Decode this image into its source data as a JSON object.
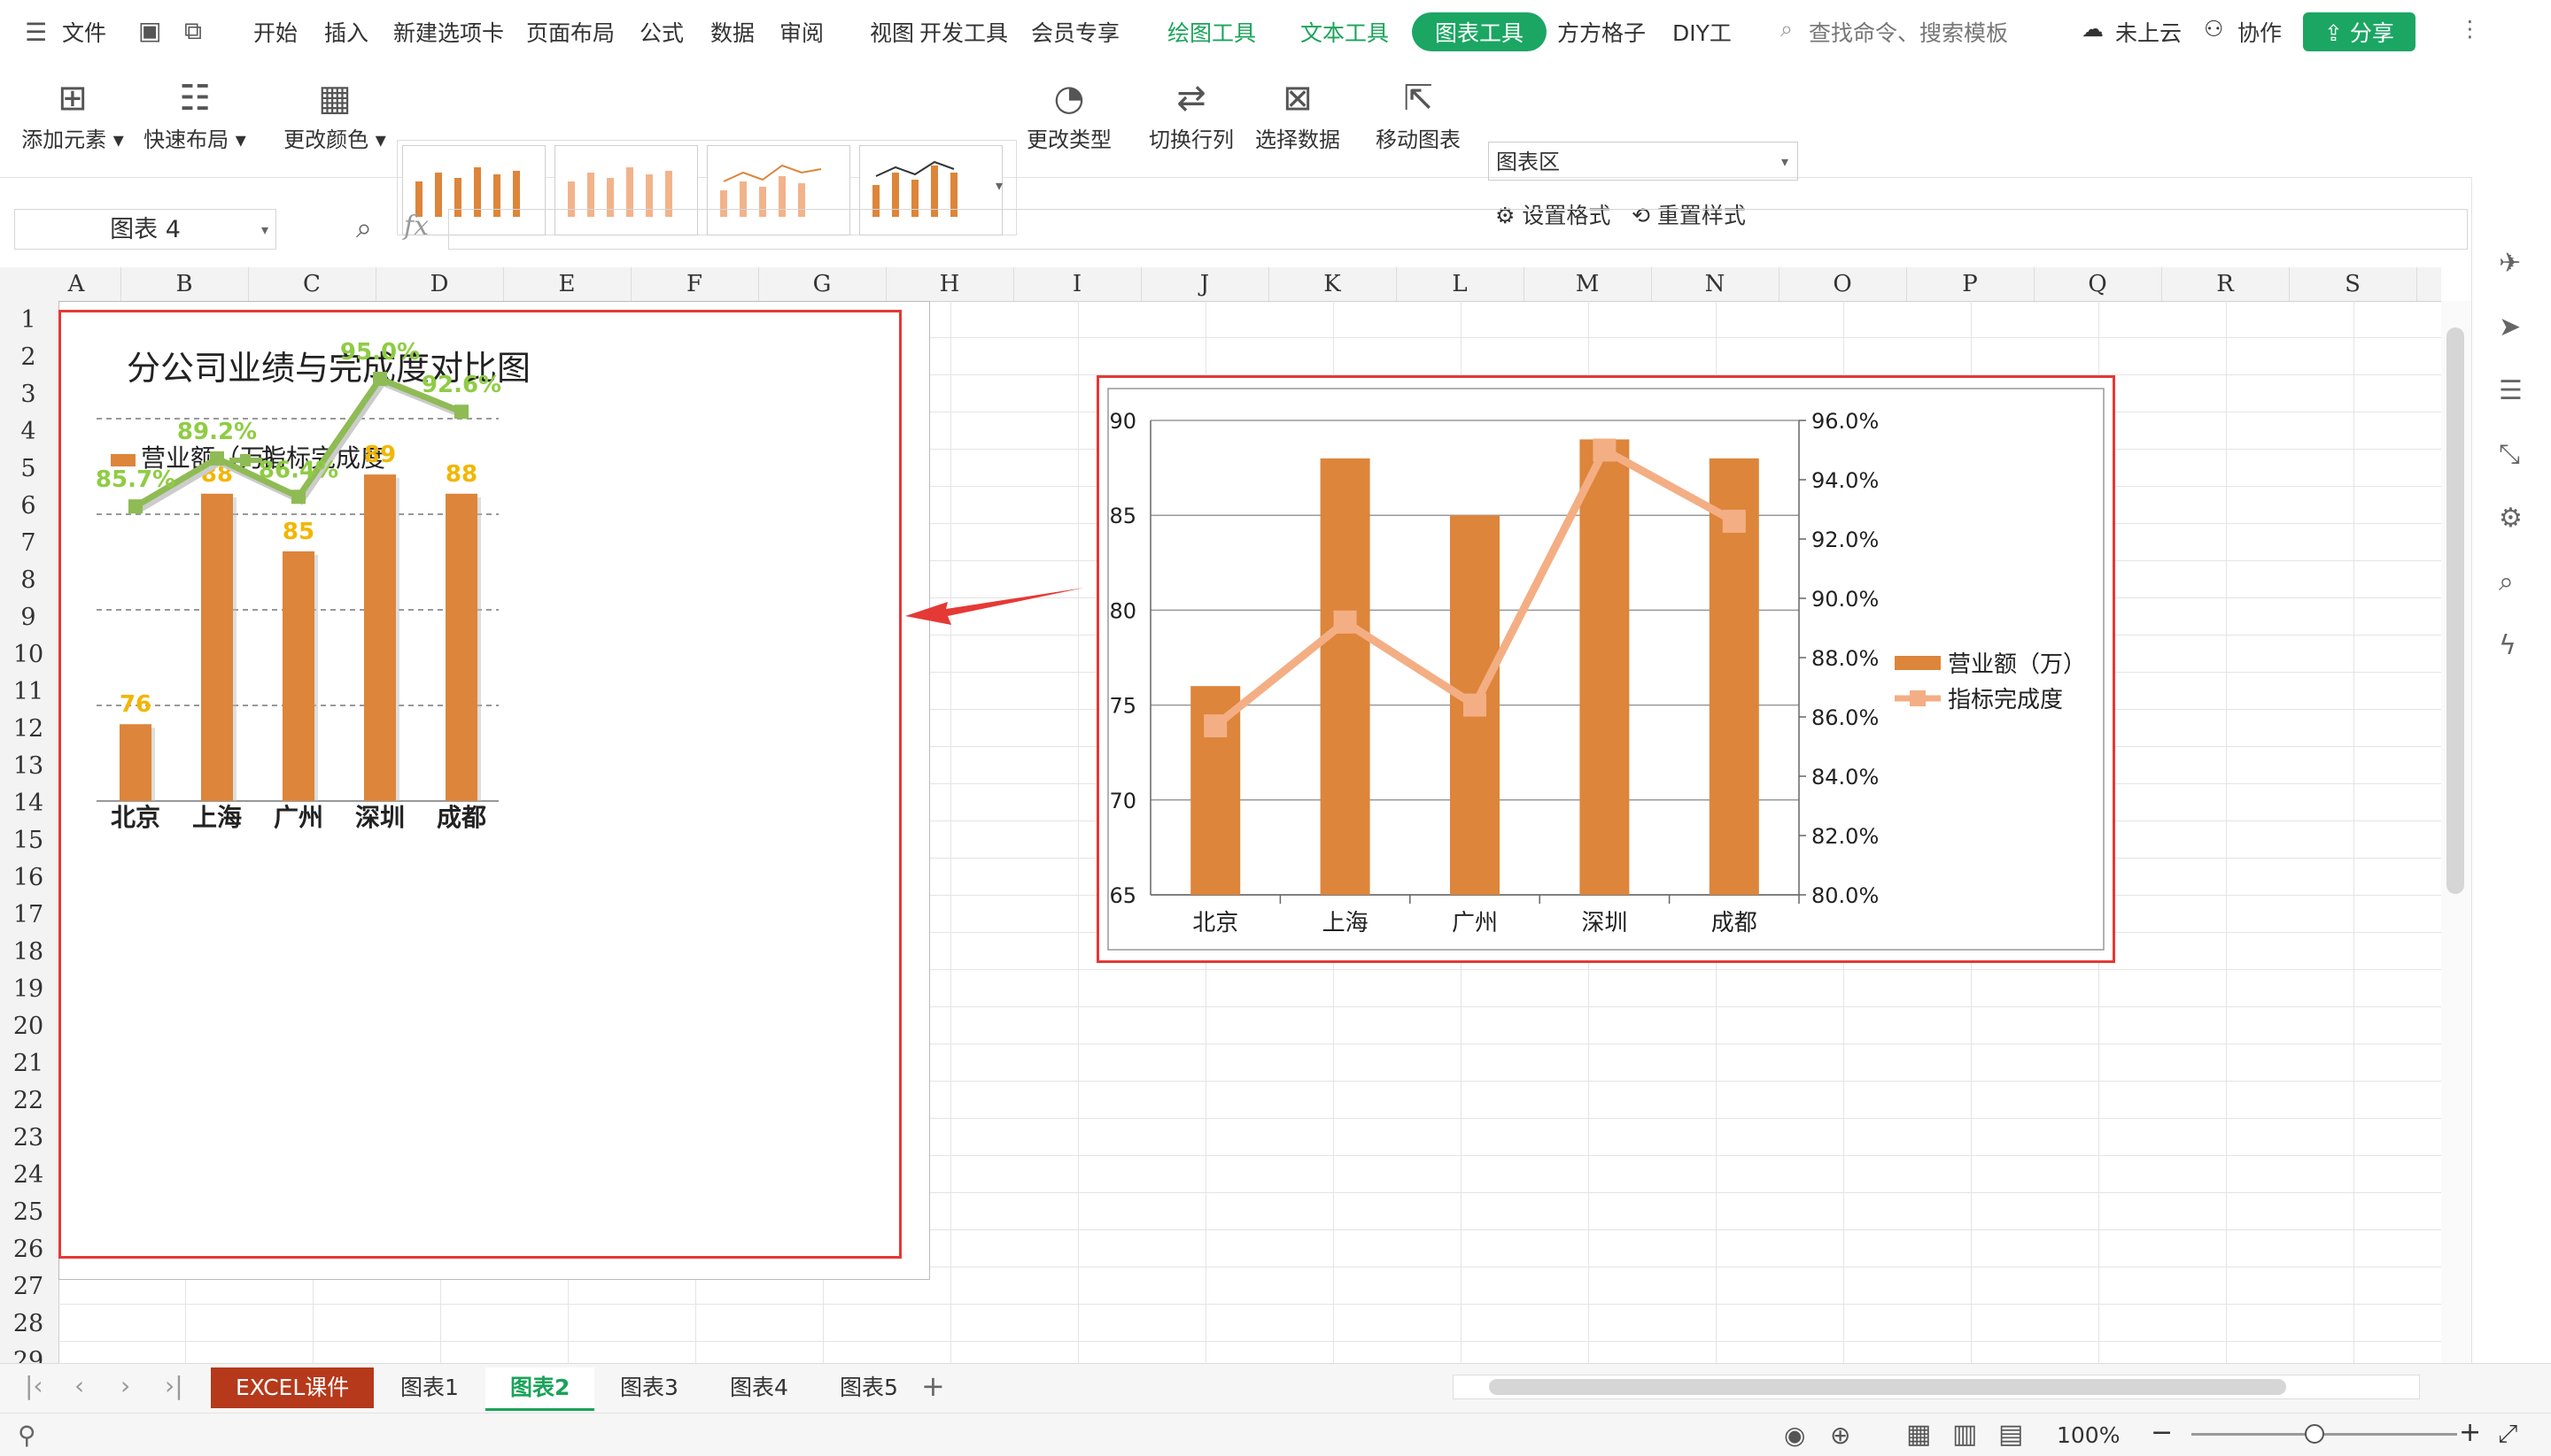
{
  "menubar": {
    "file": "文件",
    "tabs": [
      "开始",
      "插入",
      "新建选项卡",
      "页面布局",
      "公式",
      "数据",
      "审阅",
      "视图",
      "开发工具",
      "会员专享"
    ],
    "context_tabs": [
      "绘图工具",
      "文本工具",
      "图表工具"
    ],
    "extra_tabs": [
      "方方格子",
      "DIY工"
    ],
    "search_placeholder": "查找命令、搜索模板",
    "cloud": "未上云",
    "collab": "协作",
    "share": "分享"
  },
  "ribbon": {
    "add_element": "添加元素",
    "quick_layout": "快速布局",
    "change_color": "更改颜色",
    "change_type": "更改类型",
    "switch_rowcol": "切换行列",
    "select_data": "选择数据",
    "move_chart": "移动图表",
    "chart_area_select": "图表区",
    "set_format": "设置格式",
    "reset_style": "重置样式"
  },
  "formula_bar": {
    "name_box": "图表 4",
    "fx": "fx",
    "value": ""
  },
  "grid": {
    "columns": [
      "A",
      "B",
      "C",
      "D",
      "E",
      "F",
      "G",
      "H",
      "I",
      "J",
      "K",
      "L",
      "M",
      "N",
      "O",
      "P",
      "Q",
      "R",
      "S"
    ],
    "rows": [
      "1",
      "2",
      "3",
      "4",
      "5",
      "6",
      "7",
      "8",
      "9",
      "10",
      "11",
      "12",
      "13",
      "14",
      "15",
      "16",
      "17",
      "18",
      "19",
      "20",
      "21",
      "22",
      "23",
      "24",
      "25",
      "26",
      "27",
      "28",
      "29"
    ]
  },
  "sheet_tabs": [
    "EXCEL课件",
    "图表1",
    "图表2",
    "图表3",
    "图表4",
    "图表5"
  ],
  "active_tab": "图表2",
  "status": {
    "zoom": "100%"
  },
  "colors": {
    "bar": "#dd853a",
    "line_left": "#8fbb55",
    "line_right": "#f4ae84",
    "bar_label": "#f2b600",
    "line_label": "#8fcc44",
    "accent_green": "#1ba663",
    "highlight_red": "#e53935"
  },
  "chart_data": [
    {
      "type": "bar",
      "title": "分公司业绩与完成度对比图",
      "categories": [
        "北京",
        "上海",
        "广州",
        "深圳",
        "成都"
      ],
      "series": [
        {
          "name": "营业额（万）",
          "type": "bar",
          "values": [
            76,
            88,
            85,
            89,
            88
          ]
        },
        {
          "name": "指标完成度",
          "type": "line",
          "values": [
            0.857,
            0.892,
            0.864,
            0.95,
            0.926
          ]
        }
      ],
      "bar_labels": [
        "76",
        "88",
        "85",
        "89",
        "88"
      ],
      "line_labels": [
        "85.7%",
        "89.2%",
        "86.4%",
        "95.0%",
        "92.6%"
      ],
      "legend": [
        "营业额（万）",
        "指标完成度"
      ],
      "legend_position": "top-left",
      "grid": true
    },
    {
      "type": "bar",
      "title": "",
      "categories": [
        "北京",
        "上海",
        "广州",
        "深圳",
        "成都"
      ],
      "series": [
        {
          "name": "营业额（万）",
          "type": "bar",
          "axis": "left",
          "values": [
            76,
            88,
            85,
            89,
            88
          ]
        },
        {
          "name": "指标完成度",
          "type": "line",
          "axis": "right",
          "values": [
            0.857,
            0.892,
            0.864,
            0.95,
            0.926
          ]
        }
      ],
      "ylim": [
        65,
        90
      ],
      "y_ticks": [
        "65",
        "70",
        "75",
        "80",
        "85",
        "90"
      ],
      "y2lim": [
        0.8,
        0.96
      ],
      "y2_ticks": [
        "80.0%",
        "82.0%",
        "84.0%",
        "86.0%",
        "88.0%",
        "90.0%",
        "92.0%",
        "94.0%",
        "96.0%"
      ],
      "legend": [
        "营业额（万）",
        "指标完成度"
      ],
      "legend_position": "right",
      "grid": true
    }
  ]
}
